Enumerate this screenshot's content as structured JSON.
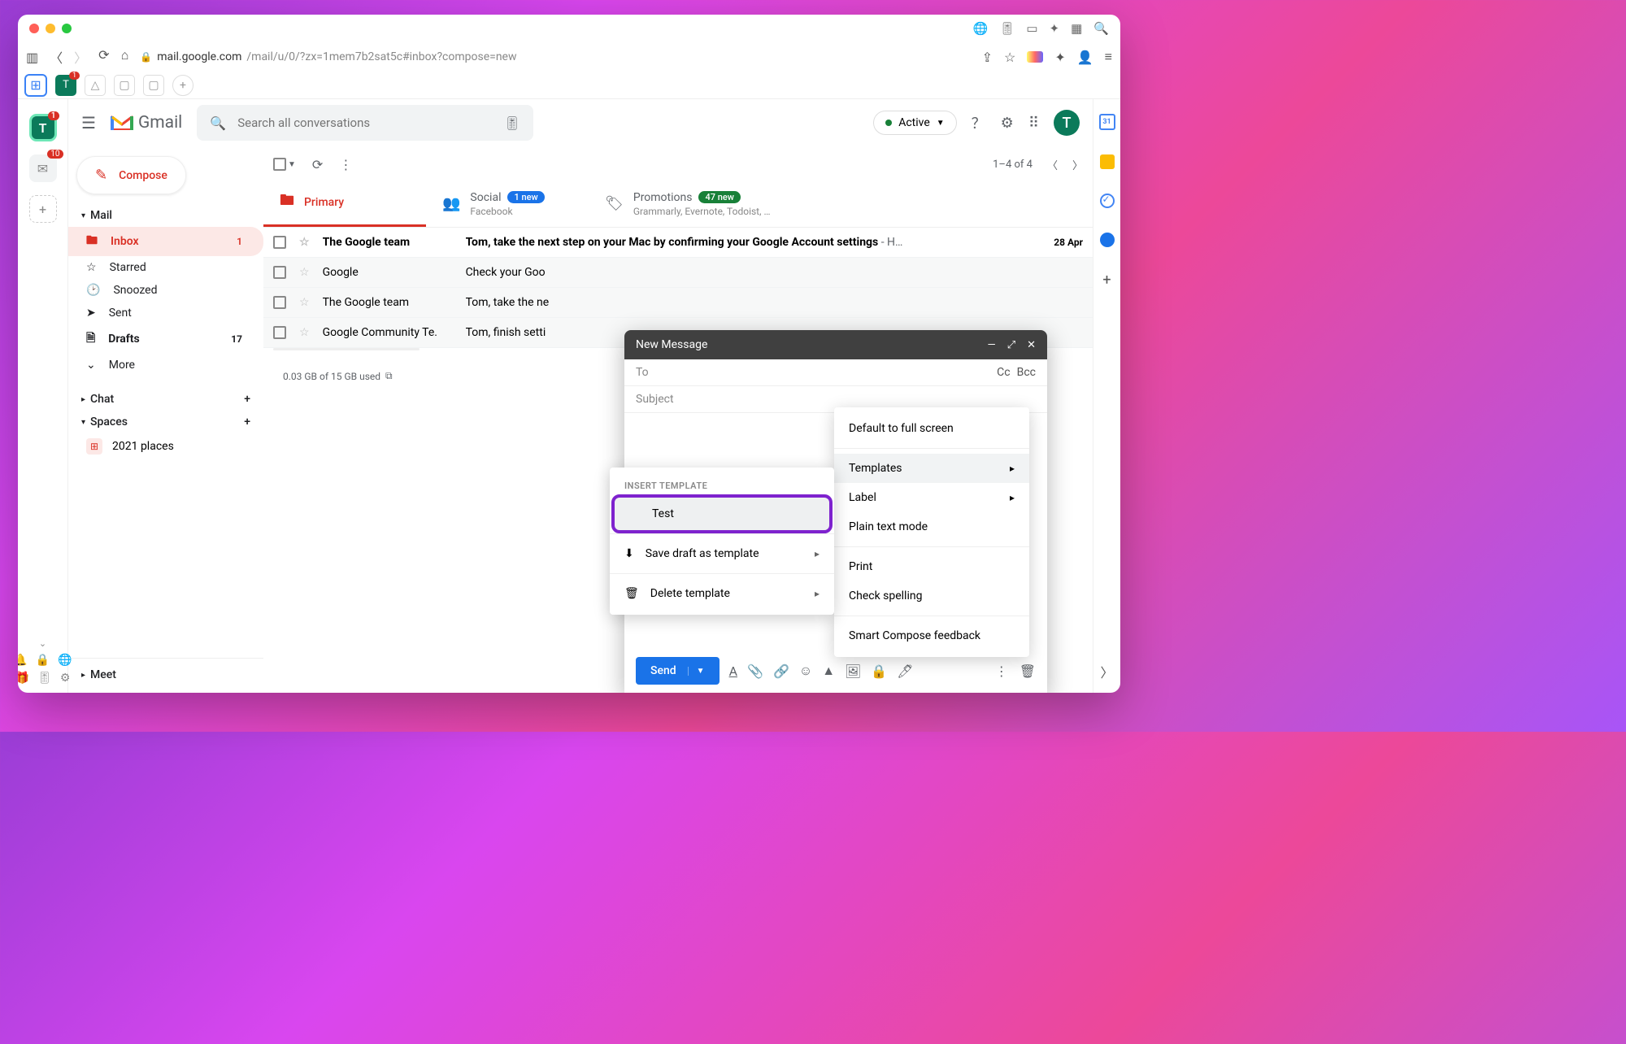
{
  "browser": {
    "url_host": "mail.google.com",
    "url_path": "/mail/u/0/?zx=1mem7b2sat5c#inbox?compose=new",
    "left_rail": {
      "avatar_letter": "T",
      "avatar_badge": "1",
      "outlook_badge": "10"
    },
    "workspace": {
      "tab_letter": "T",
      "tab_badge": "1"
    }
  },
  "gmail": {
    "brand": "Gmail",
    "search_placeholder": "Search all conversations",
    "active_label": "Active",
    "avatar_letter": "T",
    "compose": "Compose",
    "nav": {
      "mail": "Mail",
      "inbox": "Inbox",
      "inbox_count": "1",
      "starred": "Starred",
      "snoozed": "Snoozed",
      "sent": "Sent",
      "drafts": "Drafts",
      "drafts_count": "17",
      "more": "More",
      "chat": "Chat",
      "spaces": "Spaces",
      "space_1": "2021 places",
      "meet": "Meet"
    },
    "toolbar": {
      "range": "1–4 of 4"
    },
    "tabs": {
      "primary": "Primary",
      "social": "Social",
      "social_badge": "1 new",
      "social_sub": "Facebook",
      "promotions": "Promotions",
      "promotions_badge": "47 new",
      "promotions_sub": "Grammarly, Evernote, Todoist, …"
    },
    "rows": [
      {
        "sender": "The Google team",
        "subject": "Tom, take the next step on your Mac by confirming your Google Account settings",
        "preview": " - H…",
        "date": "28 Apr",
        "unread": true
      },
      {
        "sender": "Google",
        "subject": "Check your Goo",
        "preview": "",
        "date": "",
        "unread": false
      },
      {
        "sender": "The Google team",
        "subject": "Tom, take the ne",
        "preview": "",
        "date": "",
        "unread": false
      },
      {
        "sender": "Google Community Te.",
        "subject": "Tom, finish setti",
        "preview": "",
        "date": "",
        "unread": false
      }
    ],
    "storage": "0.03 GB of 15 GB used",
    "side_cal": "31"
  },
  "compose_window": {
    "title": "New Message",
    "to": "To",
    "cc": "Cc",
    "bcc": "Bcc",
    "subject_placeholder": "Subject",
    "send": "Send"
  },
  "menu_more": {
    "default_fs": "Default to full screen",
    "templates": "Templates",
    "label": "Label",
    "plain": "Plain text mode",
    "print": "Print",
    "spelling": "Check spelling",
    "feedback": "Smart Compose feedback"
  },
  "menu_templates": {
    "header": "INSERT TEMPLATE",
    "test": "Test",
    "save": "Save draft as template",
    "delete": "Delete template"
  }
}
